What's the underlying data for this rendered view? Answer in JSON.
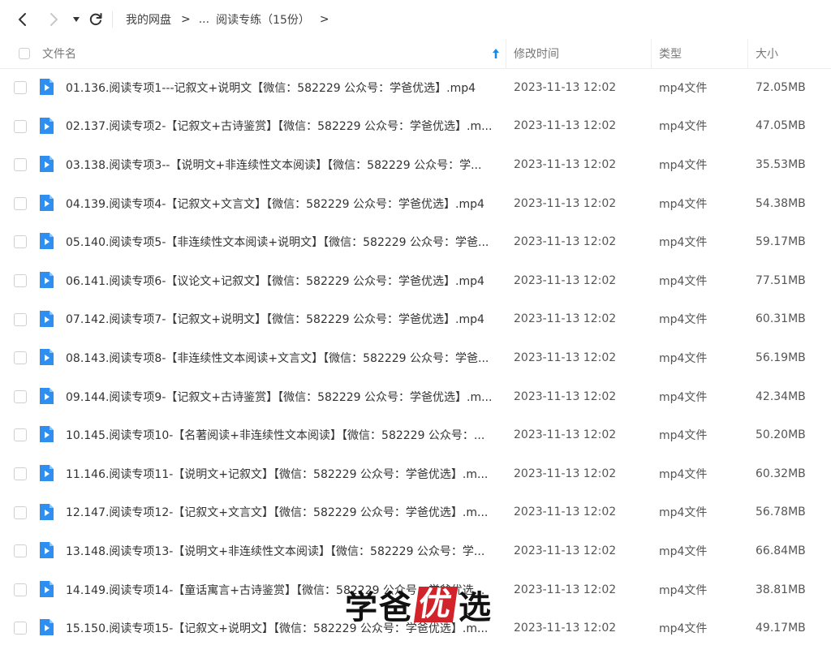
{
  "nav": {
    "path": [
      "我的网盘",
      "...",
      "阅读专练（15份）"
    ]
  },
  "columns": {
    "name": "文件名",
    "time": "修改时间",
    "type": "类型",
    "size": "大小"
  },
  "files": [
    {
      "name": "01.136.阅读专项1---记叙文+说明文【微信：582229 公众号：学爸优选】.mp4",
      "time": "2023-11-13 12:02",
      "type": "mp4文件",
      "size": "72.05MB"
    },
    {
      "name": "02.137.阅读专项2-【记叙文+古诗鉴赏】【微信：582229 公众号：学爸优选】.m...",
      "time": "2023-11-13 12:02",
      "type": "mp4文件",
      "size": "47.05MB"
    },
    {
      "name": "03.138.阅读专项3--【说明文+非连续性文本阅读】【微信：582229 公众号：学...",
      "time": "2023-11-13 12:02",
      "type": "mp4文件",
      "size": "35.53MB"
    },
    {
      "name": "04.139.阅读专项4-【记叙文+文言文】【微信：582229 公众号：学爸优选】.mp4",
      "time": "2023-11-13 12:02",
      "type": "mp4文件",
      "size": "54.38MB"
    },
    {
      "name": "05.140.阅读专项5-【非连续性文本阅读+说明文】【微信：582229 公众号：学爸...",
      "time": "2023-11-13 12:02",
      "type": "mp4文件",
      "size": "59.17MB"
    },
    {
      "name": "06.141.阅读专项6-【议论文+记叙文】【微信：582229 公众号：学爸优选】.mp4",
      "time": "2023-11-13 12:02",
      "type": "mp4文件",
      "size": "77.51MB"
    },
    {
      "name": "07.142.阅读专项7-【记叙文+说明文】【微信：582229 公众号：学爸优选】.mp4",
      "time": "2023-11-13 12:02",
      "type": "mp4文件",
      "size": "60.31MB"
    },
    {
      "name": "08.143.阅读专项8-【非连续性文本阅读+文言文】【微信：582229 公众号：学爸...",
      "time": "2023-11-13 12:02",
      "type": "mp4文件",
      "size": "56.19MB"
    },
    {
      "name": "09.144.阅读专项9-【记叙文+古诗鉴赏】【微信：582229 公众号：学爸优选】.m...",
      "time": "2023-11-13 12:02",
      "type": "mp4文件",
      "size": "42.34MB"
    },
    {
      "name": "10.145.阅读专项10-【名著阅读+非连续性文本阅读】【微信：582229 公众号：...",
      "time": "2023-11-13 12:02",
      "type": "mp4文件",
      "size": "50.20MB"
    },
    {
      "name": "11.146.阅读专项11-【说明文+记叙文】【微信：582229 公众号：学爸优选】.m...",
      "time": "2023-11-13 12:02",
      "type": "mp4文件",
      "size": "60.32MB"
    },
    {
      "name": "12.147.阅读专项12-【记叙文+文言文】【微信：582229 公众号：学爸优选】.m...",
      "time": "2023-11-13 12:02",
      "type": "mp4文件",
      "size": "56.78MB"
    },
    {
      "name": "13.148.阅读专项13-【说明文+非连续性文本阅读】【微信：582229 公众号：学...",
      "time": "2023-11-13 12:02",
      "type": "mp4文件",
      "size": "66.84MB"
    },
    {
      "name": "14.149.阅读专项14-【童话寓言+古诗鉴赏】【微信：582229 公众号：学爸优选...",
      "time": "2023-11-13 12:02",
      "type": "mp4文件",
      "size": "38.81MB"
    },
    {
      "name": "15.150.阅读专项15-【记叙文+说明文】【微信：582229 公众号：学爸优选】.m...",
      "time": "2023-11-13 12:02",
      "type": "mp4文件",
      "size": "49.17MB"
    }
  ],
  "watermark": {
    "left": "学爸",
    "highlight": "优",
    "right": "选"
  },
  "colors": {
    "accent": "#1e88e5",
    "brand": "#d2232a"
  },
  "icons": {
    "back": "chevron-left-icon",
    "forward": "chevron-right-icon",
    "dropdown": "caret-down-icon",
    "refresh": "refresh-icon",
    "sort": "sort-up-icon",
    "file": "video-file-icon"
  }
}
